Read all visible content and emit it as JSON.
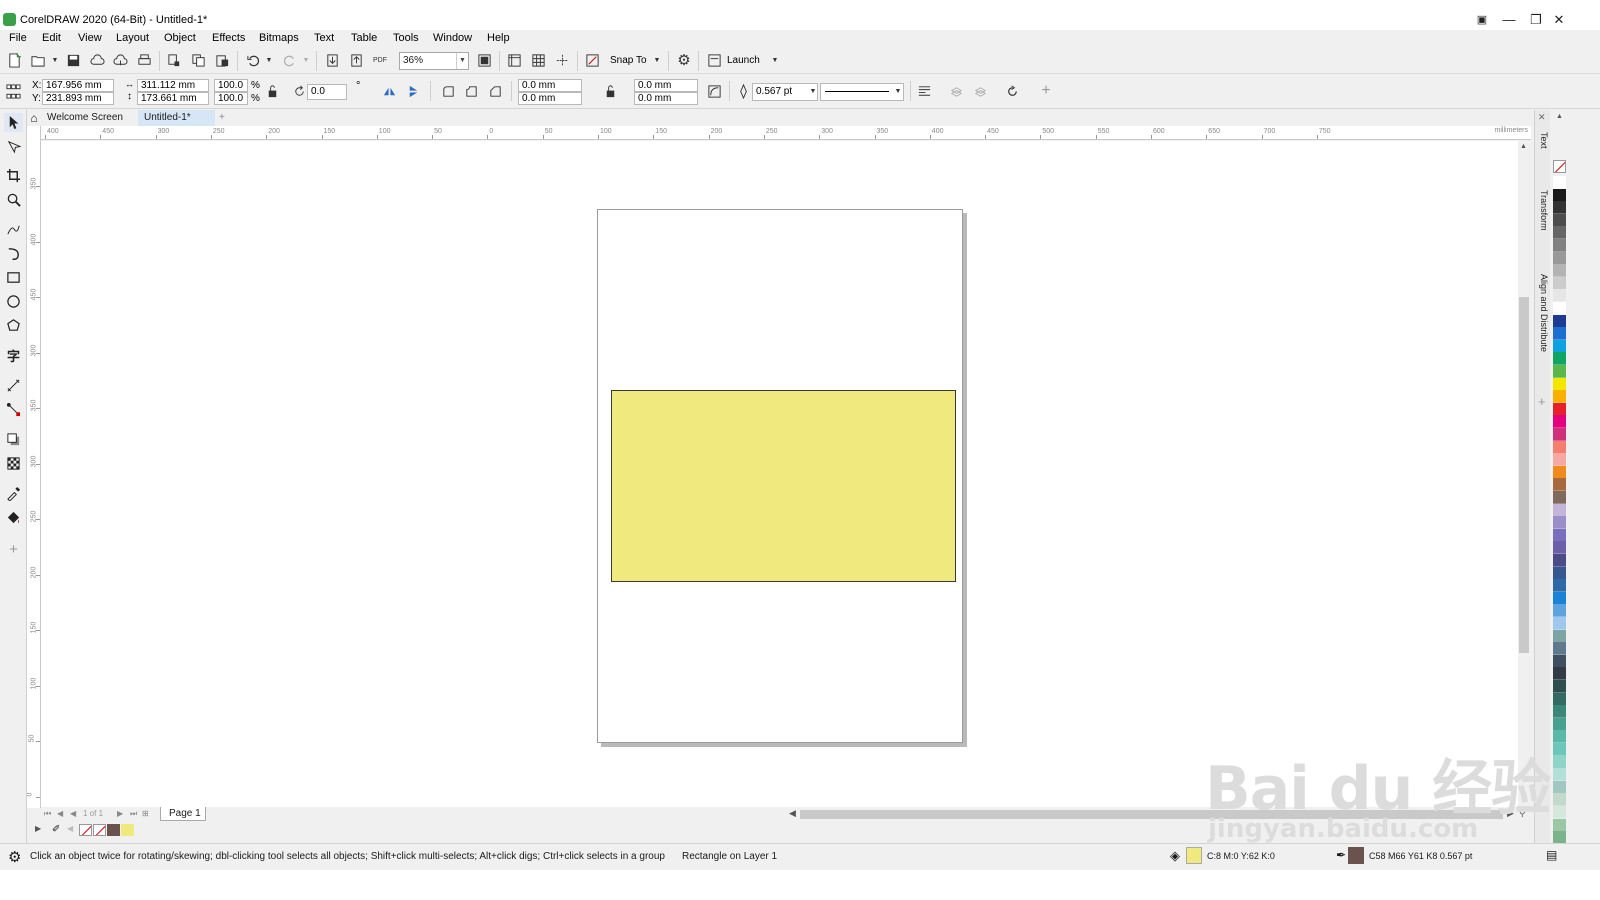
{
  "window": {
    "title": "CorelDRAW 2020 (64-Bit) - Untitled-1*"
  },
  "menu": [
    "File",
    "Edit",
    "View",
    "Layout",
    "Object",
    "Effects",
    "Bitmaps",
    "Text",
    "Table",
    "Tools",
    "Window",
    "Help"
  ],
  "toolbar": {
    "zoom_value": "36%",
    "snap_to_label": "Snap To",
    "launch_label": "Launch"
  },
  "property_bar": {
    "x_label": "X:",
    "y_label": "Y:",
    "x_value": "167.956 mm",
    "y_value": "231.893 mm",
    "width_value": "311.112 mm",
    "height_value": "173.661 mm",
    "scale_x": "100.0",
    "scale_y": "100.0",
    "percent": "%",
    "rotation": "0.0",
    "degree": "°",
    "corner_tl": "0.0 mm",
    "corner_bl": "0.0 mm",
    "corner_tr": "0.0 mm",
    "corner_br": "0.0 mm",
    "outline_width": "0.567 pt"
  },
  "tabs": {
    "welcome": "Welcome Screen",
    "document": "Untitled-1*",
    "add": "+"
  },
  "ruler": {
    "unit": "millimeters",
    "h_labels": [
      "400",
      "450",
      "300",
      "250",
      "200",
      "150",
      "100",
      "50",
      "0",
      "50",
      "100",
      "150",
      "200",
      "250",
      "300",
      "350",
      "400",
      "450",
      "500",
      "550",
      "600",
      "650",
      "700",
      "750"
    ],
    "v_labels": [
      "350",
      "400",
      "450",
      "300",
      "350",
      "300",
      "250",
      "200",
      "150",
      "100",
      "50",
      "0"
    ]
  },
  "page_nav": {
    "counter": "1 of 1",
    "page_tab": "Page 1"
  },
  "status": {
    "hint": "Click an object twice for rotating/skewing; dbl-clicking tool selects all objects; Shift+click multi-selects; Alt+click digs; Ctrl+click selects in a group",
    "selection": "Rectangle on Layer 1",
    "fill_info": "C:8 M:0 Y:62 K:0",
    "outline_info": "C58 M66 Y61 K8  0.567 pt"
  },
  "dockers": [
    "Text",
    "Transform",
    "Align and Distribute"
  ],
  "colors": {
    "rect_fill": "#f0e97d",
    "outline_color": "#6b524d",
    "accent": "#2b7cd3"
  },
  "palette": [
    "#ffffff",
    "#1a1a1a",
    "#333333",
    "#4d4d4d",
    "#666666",
    "#808080",
    "#999999",
    "#b3b3b3",
    "#cccccc",
    "#e6e6e6",
    "#ffffff",
    "#1f3a93",
    "#1c6fd1",
    "#10a2e0",
    "#11a564",
    "#5ab848",
    "#f3e600",
    "#f9b000",
    "#e6212b",
    "#e5007e",
    "#d02f79",
    "#f57f6e",
    "#f7a8a0",
    "#f08a1e",
    "#a86a3c",
    "#7f6a5e",
    "#c3b5d8",
    "#9b8fc9",
    "#7a6fbd",
    "#6d5fa8",
    "#4c4c87",
    "#37588f",
    "#2e6aa8",
    "#1c82d6",
    "#5fa3dc",
    "#9ec9ec",
    "#7ea4a4",
    "#5f7a8c",
    "#415061",
    "#323c47",
    "#2f4f4f",
    "#336b63",
    "#3b8778",
    "#48a08f",
    "#5ab8a6",
    "#6dc6b9",
    "#8fd3c9",
    "#b2e0d9",
    "#a0c7c2",
    "#c2d9cc",
    "#d6e8dd",
    "#9cc7a4",
    "#7db38a"
  ],
  "watermark": {
    "brand": "Bai   du 经验",
    "url": "jingyan.baidu.com"
  }
}
